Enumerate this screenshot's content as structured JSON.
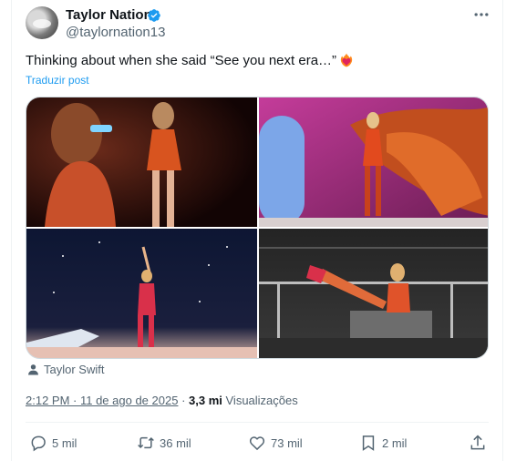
{
  "author": {
    "display_name": "Taylor Nation",
    "handle": "@taylornation13",
    "verified": true,
    "avatar_icon": "avatar-image"
  },
  "tweet": {
    "text": "Thinking about when she said “See you next era…”",
    "emoji_icon": "heart-on-fire-emoji",
    "translate_label": "Traduzir post"
  },
  "media": [
    {
      "icon": "photo-concert-closeup-red-outfit"
    },
    {
      "icon": "photo-stage-orange-wings"
    },
    {
      "icon": "photo-stage-arm-raised"
    },
    {
      "icon": "photo-stage-seated-platform"
    }
  ],
  "tagged": {
    "label": "Taylor Swift",
    "icon": "person-icon"
  },
  "meta": {
    "time": "2:12 PM · 11 de ago de 2025",
    "separator": " · ",
    "views_count": "3,3 mi",
    "views_label": "Visualizações"
  },
  "actions": {
    "replies": "5 mil",
    "reposts": "36 mil",
    "likes": "73 mil",
    "bookmarks": "2 mil"
  },
  "colors": {
    "accent": "#1d9bf0",
    "text_primary": "#0f1419",
    "text_secondary": "#536471",
    "border": "#eff3f4"
  }
}
